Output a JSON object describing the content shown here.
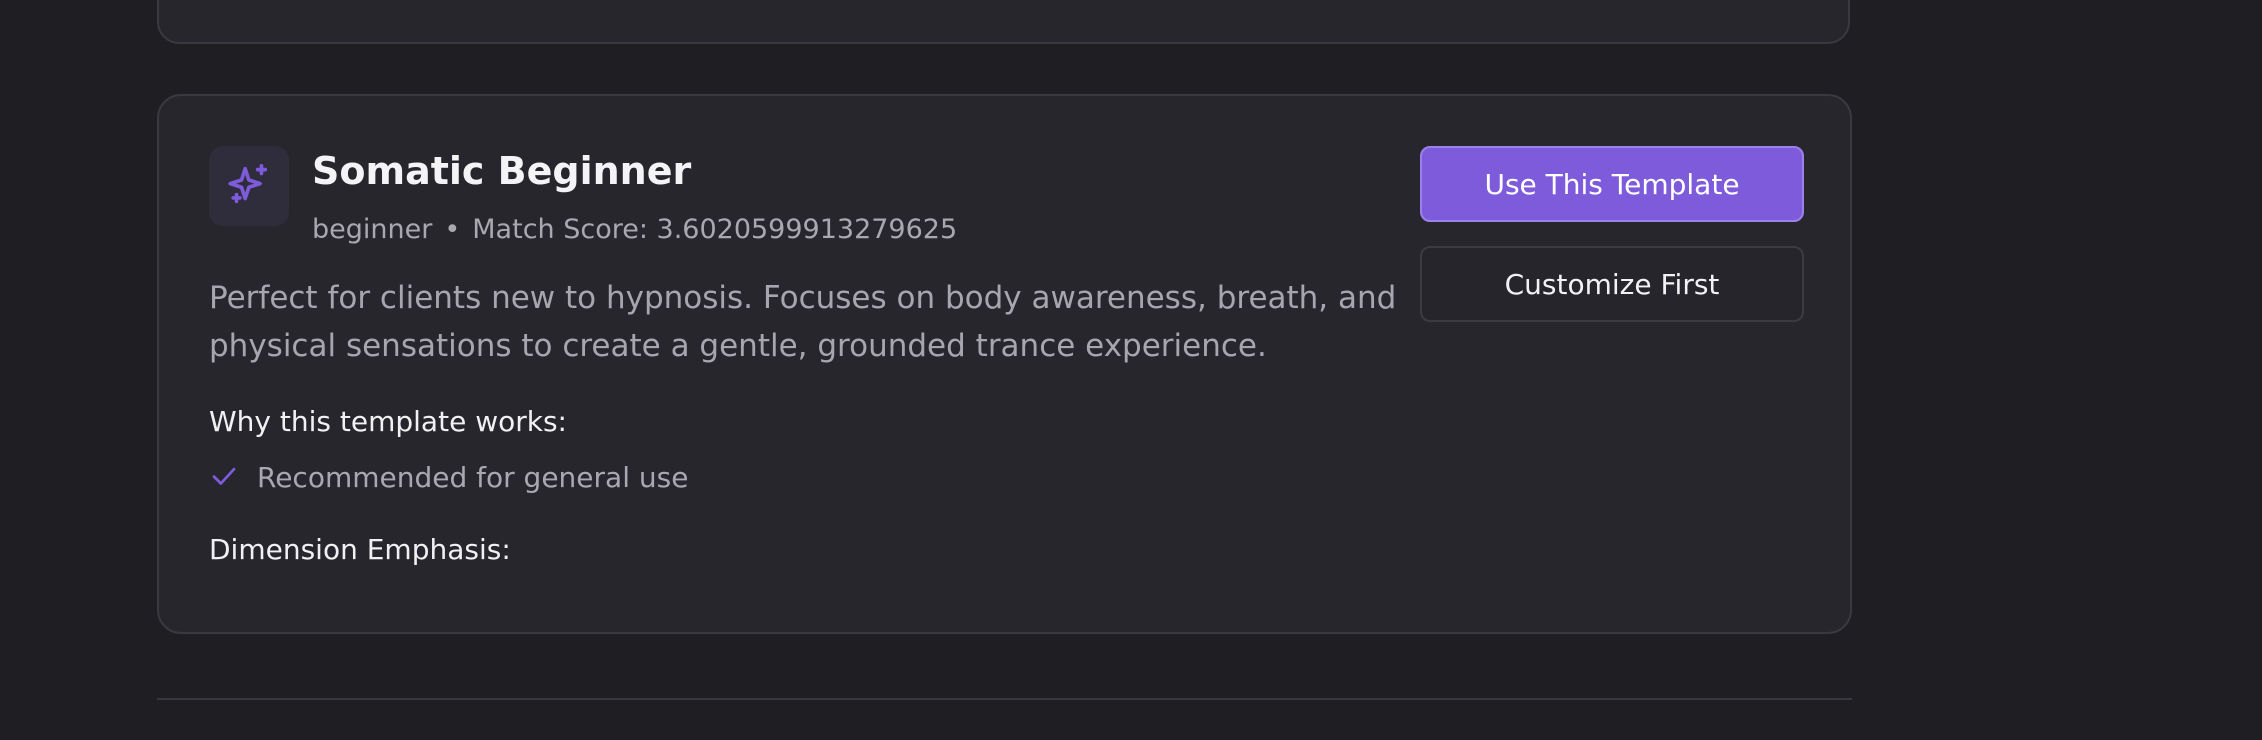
{
  "template": {
    "title": "Somatic Beginner",
    "level": "beginner",
    "separator": "•",
    "match_score_text": "Match Score: 3.6020599913279625",
    "description": "Perfect for clients new to hypnosis. Focuses on body awareness, breath, and physical sensations to create a gentle, grounded trance experience.",
    "why_heading": "Why this template works:",
    "reasons": [
      {
        "text": "Recommended for general use",
        "icon": "check-icon"
      }
    ],
    "dimension_heading": "Dimension Emphasis:",
    "icon": "sparkles-icon"
  },
  "actions": {
    "use_label": "Use This Template",
    "customize_label": "Customize First"
  },
  "colors": {
    "accent": "#7d5bdb",
    "background": "#1f1e23",
    "card": "#27262c"
  }
}
